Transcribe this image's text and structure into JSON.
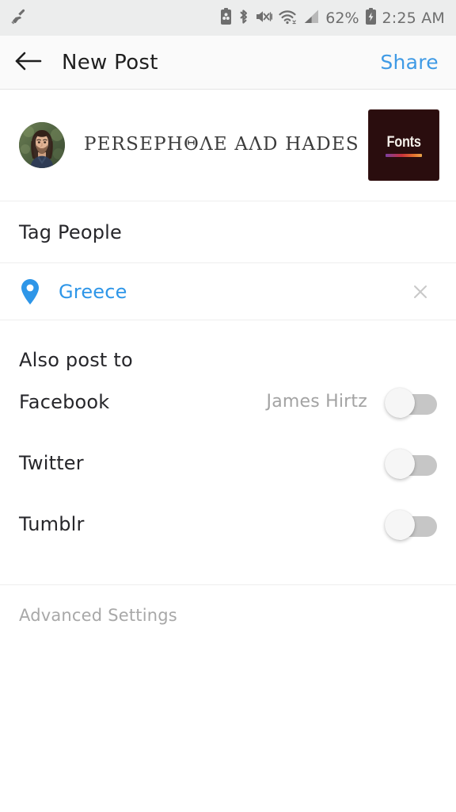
{
  "statusbar": {
    "left_icons": [
      "broom-cleaner-icon"
    ],
    "right_icons": [
      "battery-saver-icon",
      "bluetooth-icon",
      "vibrate-mute-icon",
      "wifi-icon",
      "cellular-signal-icon",
      "battery-charging-icon"
    ],
    "battery_percent": "62%",
    "time": "2:25 AM",
    "bg_color": "#eceded",
    "icon_color": "#6e6e6e"
  },
  "appbar": {
    "back_icon": "arrow-left-icon",
    "title": "New Post",
    "share_label": "Share",
    "share_color": "#3f9ae5",
    "bg_color": "#fafafa"
  },
  "caption": {
    "avatar": "user-avatar",
    "text": "PERSEPHΘΛE AΛD HADES",
    "fonts_button": {
      "label": "Fonts",
      "bg_color": "#2a0d0e",
      "underline_gradient": [
        "#7b3fa0",
        "#c8323c",
        "#e4732e",
        "#e9a54a"
      ]
    }
  },
  "tag_people": {
    "label": "Tag People"
  },
  "location": {
    "pin_icon": "location-pin-icon",
    "name": "Greece",
    "name_color": "#2e96e8",
    "clear_icon": "close-x-icon"
  },
  "also_post_to": {
    "title": "Also post to",
    "items": [
      {
        "label": "Facebook",
        "account": "James Hirtz",
        "enabled": false
      },
      {
        "label": "Twitter",
        "account": "",
        "enabled": false
      },
      {
        "label": "Tumblr",
        "account": "",
        "enabled": false
      }
    ]
  },
  "advanced": {
    "label": "Advanced Settings",
    "color": "#a8a8a8"
  }
}
